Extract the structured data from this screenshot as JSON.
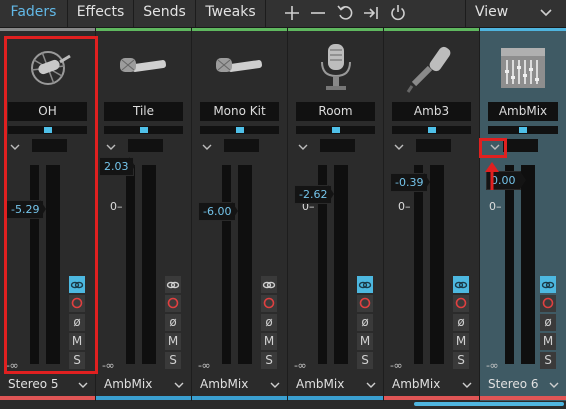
{
  "toolbar": {
    "tabs": [
      {
        "label": "Faders",
        "active": true
      },
      {
        "label": "Effects",
        "active": false
      },
      {
        "label": "Sends",
        "active": false
      },
      {
        "label": "Tweaks",
        "active": false
      }
    ],
    "icons": [
      "add-icon",
      "remove-icon",
      "undo-icon",
      "expand-icon",
      "power-icon"
    ],
    "view_label": "View"
  },
  "channels": [
    {
      "name": "OH",
      "icon": "overhead-mic-icon",
      "value": "-5.29",
      "zero": "0",
      "neg_inf": "-∞",
      "output": "Stereo 5",
      "color": "#e05555",
      "top_color": "#888888",
      "link_active": true,
      "selected": false
    },
    {
      "name": "Tile",
      "icon": "handheld-mic-icon",
      "value": "2.03",
      "zero": "0",
      "neg_inf": "-∞",
      "output": "AmbMix",
      "color": "#3a9fd0",
      "top_color": "#5fb85f",
      "link_active": false,
      "selected": false
    },
    {
      "name": "Mono Kit",
      "icon": "handheld-mic-icon",
      "value": "-6.00",
      "zero": "0",
      "neg_inf": "-∞",
      "output": "AmbMix",
      "color": "#3a9fd0",
      "top_color": "#5fb85f",
      "link_active": false,
      "selected": false
    },
    {
      "name": "Room",
      "icon": "condenser-mic-icon",
      "value": "-2.62",
      "zero": "0",
      "neg_inf": "-∞",
      "output": "AmbMix",
      "color": "#3a9fd0",
      "top_color": "#5fb85f",
      "link_active": true,
      "selected": false
    },
    {
      "name": "Amb3",
      "icon": "angled-mic-icon",
      "value": "-0.39",
      "zero": "0",
      "neg_inf": "-∞",
      "output": "AmbMix",
      "color": "#e05555",
      "top_color": "#5fb85f",
      "link_active": true,
      "selected": false
    },
    {
      "name": "AmbMix",
      "icon": "mixer-icon",
      "value": "0.00",
      "zero": "0",
      "neg_inf": "-∞",
      "output": "Stereo 6",
      "color": "#e05555",
      "top_color": "#4fb5df",
      "link_active": true,
      "selected": true
    }
  ],
  "buttons": {
    "mute": "M",
    "solo": "S",
    "phase": "ø"
  },
  "colors": {
    "accent": "#4fb5df",
    "annotation": "#e02020"
  }
}
